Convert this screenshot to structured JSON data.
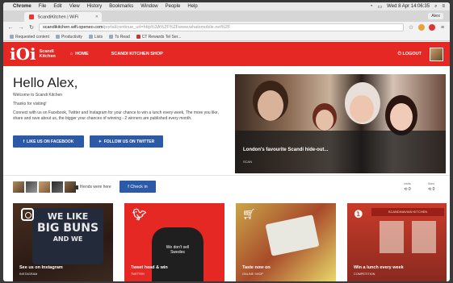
{
  "mac_menu": {
    "apple": "",
    "items": [
      "Chrome",
      "File",
      "Edit",
      "View",
      "History",
      "Bookmarks",
      "Window",
      "People",
      "Help"
    ],
    "clock": "Wed 8 Apr 14:06:35"
  },
  "browser": {
    "tab_title": "ScandiKitchen | WiFi",
    "user_button": "Alex",
    "url_host": "scandikitchen.wifi.openeo.com",
    "url_rest": "/portal/continue_url=http%3A%2F%2Fwww.whatsmobile.net%2F",
    "bookmarks": [
      "Requested content",
      "Productivity",
      "Lists",
      "To Read",
      "CT Rewards Tel Ser..."
    ]
  },
  "site": {
    "logo_mark": "iOi",
    "logo_line1": "Scandi",
    "logo_line2": "Kitchen",
    "nav_home": "HOME",
    "nav_online_shop": "SCANDI KITCHEN SHOP",
    "logout": "LOGOUT"
  },
  "hero": {
    "greeting": "Hello Alex,",
    "welcome": "Welcome to Scandi Kitchen",
    "thanks": "Thanks for visiting!",
    "body": "Connect with us on Facebook, Twitter and Instagram for your chance to win a lunch every week. The more you like, share and rave about us, the bigger your chances of winning - 2 winners are published every month.",
    "btn_facebook": "LIKE US ON FACEBOOK",
    "btn_twitter": "FOLLOW US ON TWITTER",
    "image_caption": "London's favourite Scandi hide-out...",
    "image_sub": "SCAN"
  },
  "social": {
    "friends_text": "friends were here",
    "share_button": "Check in",
    "stat1_label": "visits",
    "stat1_value": "0",
    "stat2_label": "likes",
    "stat2_value": "0"
  },
  "cards": [
    {
      "caption": "See us on Instagram",
      "sub": "INSTAGRAM",
      "sign1": "WE LIKE",
      "sign2": "BIG BUNS",
      "sign3": "AND WE"
    },
    {
      "caption": "Tweet head & win",
      "sub": "TWITTER",
      "shirt": "We don't sell Swedes"
    },
    {
      "caption": "Taste now on",
      "sub": "ONLINE SHOP"
    },
    {
      "caption": "Win a lunch every week",
      "sub": "COMPETITION",
      "store": "SCANDINAVIAN KITCHEN"
    }
  ],
  "colors": {
    "brand_red": "#e62824",
    "button_blue": "#2d5aa8"
  }
}
